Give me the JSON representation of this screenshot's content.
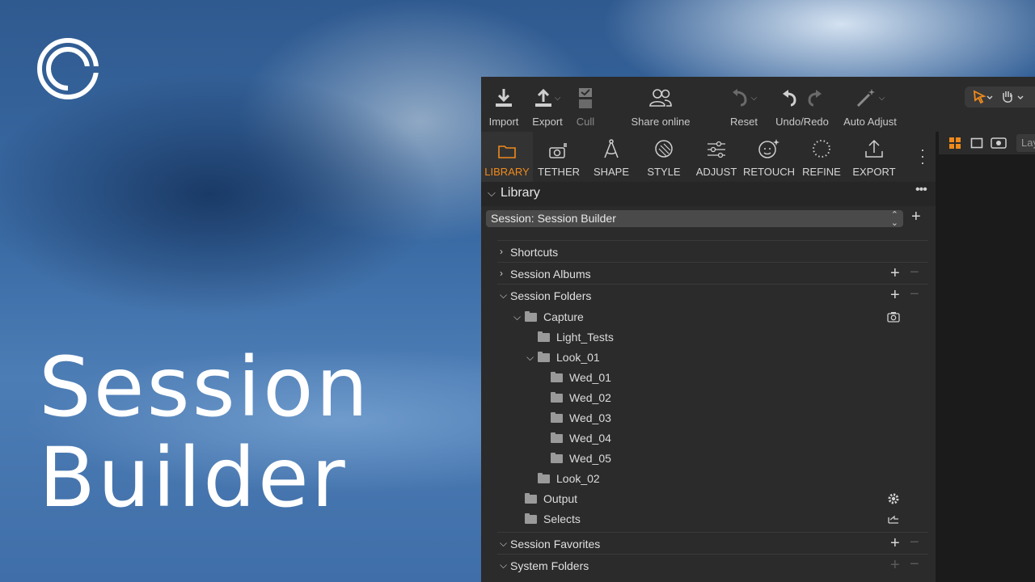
{
  "hero": {
    "line1": "Session",
    "line2": "Builder"
  },
  "toolbar": {
    "import": "Import",
    "export": "Export",
    "cull": "Cull",
    "share_online": "Share online",
    "reset": "Reset",
    "undo_redo": "Undo/Redo",
    "auto_adjust": "Auto Adjust"
  },
  "tabs": [
    {
      "label": "LIBRARY",
      "icon": "folder-icon"
    },
    {
      "label": "TETHER",
      "icon": "camera-tether-icon"
    },
    {
      "label": "SHAPE",
      "icon": "compass-icon"
    },
    {
      "label": "STYLE",
      "icon": "style-icon"
    },
    {
      "label": "ADJUST",
      "icon": "sliders-icon"
    },
    {
      "label": "RETOUCH",
      "icon": "retouch-icon"
    },
    {
      "label": "REFINE",
      "icon": "refine-icon"
    },
    {
      "label": "EXPORT",
      "icon": "export-icon"
    }
  ],
  "library": {
    "title": "Library",
    "session_select": "Session: Session Builder"
  },
  "sections": {
    "shortcuts": "Shortcuts",
    "session_albums": "Session Albums",
    "session_folders": "Session Folders",
    "session_favorites": "Session Favorites",
    "system_folders": "System Folders"
  },
  "folders": {
    "capture": "Capture",
    "light_tests": "Light_Tests",
    "look_01": "Look_01",
    "wed_01": "Wed_01",
    "wed_02": "Wed_02",
    "wed_03": "Wed_03",
    "wed_04": "Wed_04",
    "wed_05": "Wed_05",
    "look_02": "Look_02",
    "output": "Output",
    "selects": "Selects"
  },
  "viewer": {
    "layer_input": "Lay"
  },
  "colors": {
    "accent": "#f08a1c",
    "panel": "#2b2b2b",
    "text": "#e0e0e0"
  }
}
